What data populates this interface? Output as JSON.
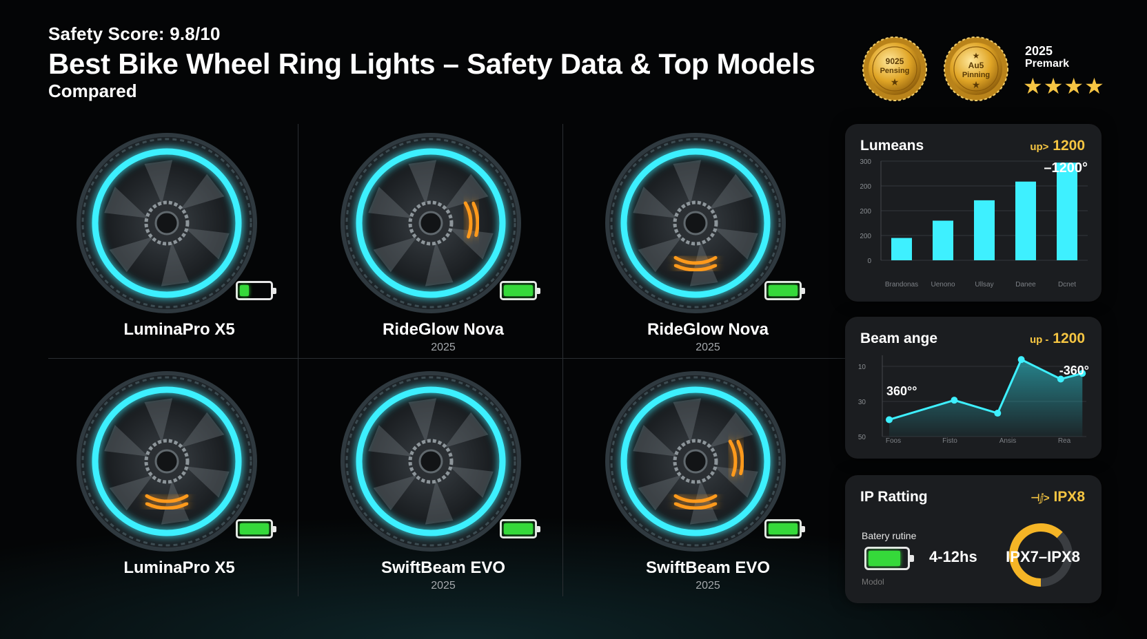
{
  "header": {
    "safety_score": "Safety Score: 9.8/10",
    "title": "Best Bike Wheel Ring Lights – Safety Data & Top Models",
    "subtitle": "Compared"
  },
  "awards": {
    "badges": [
      {
        "line1": "9025",
        "line2": "Pensing"
      },
      {
        "line1": "Au5",
        "line2": "Pinning"
      }
    ],
    "year": "2025",
    "name": "Premark",
    "stars": "★★★★"
  },
  "colors": {
    "accent": "#3ef0ff",
    "gold": "#f5c542",
    "battery": "#35d93a",
    "glow_orange": "#ff9a1f",
    "panel": "#1b1d20"
  },
  "products": [
    {
      "name": "LuminaPro X5",
      "year": "",
      "battery_level": 0.3,
      "orange_arc": "none"
    },
    {
      "name": "RideGlow Nova",
      "year": "2025",
      "battery_level": 1.0,
      "orange_arc": "right"
    },
    {
      "name": "RideGlow Nova",
      "year": "2025",
      "battery_level": 1.0,
      "orange_arc": "bottom"
    },
    {
      "name": "LuminaPro X5",
      "year": "",
      "battery_level": 1.0,
      "orange_arc": "bottom"
    },
    {
      "name": "SwiftBeam EVO",
      "year": "2025",
      "battery_level": 1.0,
      "orange_arc": "none"
    },
    {
      "name": "SwiftBeam EVO",
      "year": "2025",
      "battery_level": 1.0,
      "orange_arc": "both"
    }
  ],
  "panels": {
    "lumens": {
      "title": "Lumeans",
      "badge_prefix": "up>",
      "badge_value": "1200",
      "annotation": "–1200°"
    },
    "beam": {
      "title": "Beam ange",
      "badge_prefix": "up -",
      "badge_value": "1200",
      "annotation_left": "360°°",
      "annotation_right": "-360°"
    },
    "ip": {
      "title": "IP Ratting",
      "badge_prefix": "⊣ⅉ>",
      "badge_value": "IPX8",
      "label": "Batery rutine",
      "runtime": "4-12hs",
      "range": "IPX7–IPX8",
      "footer": "Modol",
      "battery_level": 0.85,
      "ring_fraction": 0.62
    }
  },
  "chart_data": [
    {
      "type": "bar",
      "title": "Lumeans",
      "categories": [
        "Brandonas",
        "Uenono",
        "Ullsay",
        "Danee",
        "Dcnet"
      ],
      "values": [
        80,
        142,
        215,
        282,
        350
      ],
      "yticks": [
        "300",
        "200",
        "200",
        "200",
        "0"
      ],
      "ylim": [
        0,
        380
      ],
      "grid": true
    },
    {
      "type": "area",
      "title": "Beam ange",
      "x": [
        "Foos",
        "",
        "Fisto",
        "",
        "Ansis",
        "",
        "Rea"
      ],
      "values": [
        14,
        38,
        22,
        88,
        64,
        71
      ],
      "yticks": [
        "10",
        "30",
        "50"
      ],
      "ylim": [
        0,
        100
      ],
      "grid": true
    }
  ]
}
